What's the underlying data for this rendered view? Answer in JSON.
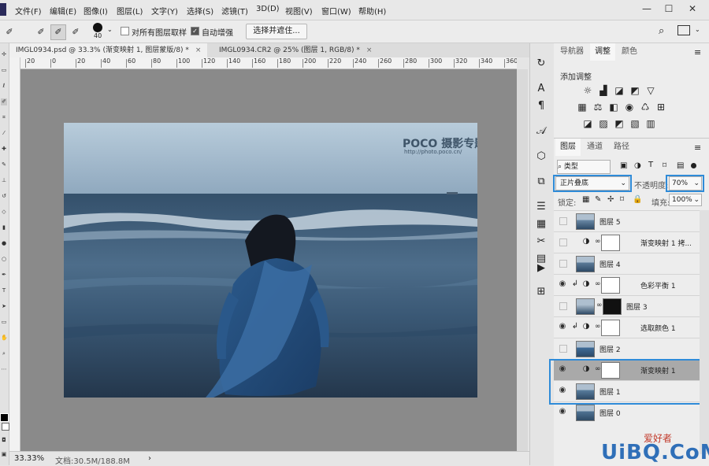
{
  "menu": {
    "items": [
      "文件(F)",
      "编辑(E)",
      "图像(I)",
      "图层(L)",
      "文字(Y)",
      "选择(S)",
      "滤镜(T)",
      "3D(D)",
      "视图(V)",
      "窗口(W)",
      "帮助(H)"
    ],
    "window_controls": [
      "—",
      "☐",
      "✕"
    ]
  },
  "options_bar": {
    "brush_size": "40",
    "sample_all_layers": "对所有图层取样",
    "auto_enhance": "自动增强",
    "select_mask_button": "选择并遮住..."
  },
  "document_tabs": [
    {
      "label": "IMGL0934.psd @ 33.3% (渐变映射 1, 图层蒙版/8) *",
      "close": "×"
    },
    {
      "label": "IMGL0934.CR2 @ 25% (图层 1, RGB/8) *",
      "close": "×"
    }
  ],
  "ruler": {
    "ticks": [
      "20",
      "0",
      "20",
      "40",
      "60",
      "80",
      "100",
      "120",
      "140",
      "160",
      "180",
      "200",
      "220",
      "240",
      "260",
      "280",
      "300",
      "320",
      "340",
      "360"
    ]
  },
  "photo": {
    "watermark_brand": "POCO 摄影专题",
    "watermark_url": "http://photo.poco.cn/"
  },
  "status_bar": {
    "zoom": "33.33%",
    "doc_info": "文档:30.5M/188.8M",
    "arrow": "›"
  },
  "top_panel": {
    "tabs": [
      "导航器",
      "调整",
      "颜色"
    ],
    "active_tab": "调整",
    "add_adjustment": "添加调整"
  },
  "layers_panel": {
    "tabs": [
      "图层",
      "通道",
      "路径"
    ],
    "active_tab": "图层",
    "kind_filter": "类型",
    "blend_mode": "正片叠底",
    "opacity_label": "不透明度:",
    "opacity_value": "70%",
    "lock_label": "锁定:",
    "fill_label": "填充:",
    "fill_value": "100%",
    "layers": [
      {
        "name": "图层 5",
        "visible": false,
        "kind": "image",
        "selected": false
      },
      {
        "name": "渐变映射 1 拷...",
        "visible": false,
        "kind": "adjustment",
        "selected": false
      },
      {
        "name": "图层 4",
        "visible": false,
        "kind": "image",
        "selected": false
      },
      {
        "name": "色彩平衡 1",
        "visible": true,
        "kind": "adjustment-clipped",
        "selected": false
      },
      {
        "name": "图层 3",
        "visible": false,
        "kind": "image-mask",
        "selected": false
      },
      {
        "name": "选取颜色 1",
        "visible": true,
        "kind": "adjustment-clipped",
        "selected": false
      },
      {
        "name": "图层 2",
        "visible": false,
        "kind": "image",
        "selected": false
      },
      {
        "name": "渐变映射 1",
        "visible": true,
        "kind": "adjustment",
        "selected": true
      },
      {
        "name": "图层 1",
        "visible": true,
        "kind": "image",
        "selected": false
      },
      {
        "name": "图层 0",
        "visible": true,
        "kind": "image",
        "selected": false
      }
    ]
  },
  "site_watermark": {
    "text": "UiBQ.CoM",
    "subtext": "爱好者"
  },
  "colors": {
    "highlight": "#2f8bd8",
    "selected_row": "#a9a9a9",
    "canvas_bg": "#8a8a8a"
  }
}
